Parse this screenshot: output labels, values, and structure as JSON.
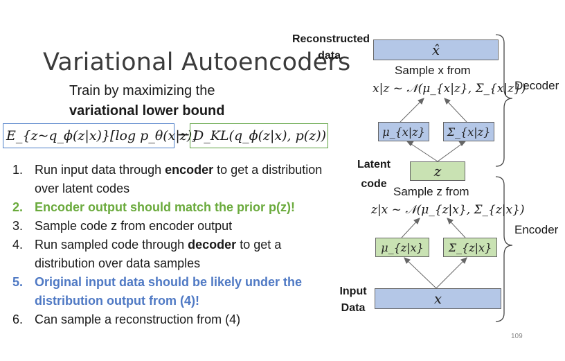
{
  "slide": {
    "title": "Variational Autoencoders",
    "subtitle_line1": "Train by maximizing the",
    "subtitle_line2": "variational lower bound",
    "formula_expectation": "E_{z~q_ϕ(z|x)}[log p_θ(x|z)]",
    "formula_minus": "−",
    "formula_kl": "D_KL(q_ϕ(z|x), p(z))",
    "page_number": "109"
  },
  "steps": [
    {
      "num": "1.",
      "parts": [
        {
          "t": "Run input data through "
        },
        {
          "t": "encoder",
          "b": true
        },
        {
          "t": " to get a distribution over latent codes"
        }
      ],
      "style": "normal"
    },
    {
      "num": "2.",
      "text": "Encoder output should match the prior p(z)!",
      "style": "green"
    },
    {
      "num": "3.",
      "text": "Sample code z from encoder output",
      "style": "normal"
    },
    {
      "num": "4.",
      "parts": [
        {
          "t": "Run sampled code through "
        },
        {
          "t": "decoder",
          "b": true
        },
        {
          "t": " to get a distribution over data samples"
        }
      ],
      "style": "normal"
    },
    {
      "num": "5.",
      "text": "Original input data should be likely under the distribution output from (4)!",
      "style": "blue"
    },
    {
      "num": "6.",
      "text": "Can sample a reconstruction from (4)",
      "style": "normal"
    }
  ],
  "diagram": {
    "reconstructed_label_1": "Reconstructed",
    "reconstructed_label_2": "data",
    "xhat": "x̂",
    "sample_x_text": "Sample x from",
    "sample_x_eq": "x|z ~ 𝒩(μ_{x|z}, Σ_{x|z})",
    "mu_xz": "μ_{x|z}",
    "sigma_xz": "Σ_{x|z}",
    "latent_label_1": "Latent",
    "latent_label_2": "code",
    "z": "z",
    "sample_z_text": "Sample z from",
    "sample_z_eq": "z|x ~ 𝒩(μ_{z|x}, Σ_{z|x})",
    "mu_zx": "μ_{z|x}",
    "sigma_zx": "Σ_{z|x}",
    "input_label_1": "Input",
    "input_label_2": "Data",
    "x": "x",
    "decoder_label": "Decoder",
    "encoder_label": "Encoder"
  }
}
